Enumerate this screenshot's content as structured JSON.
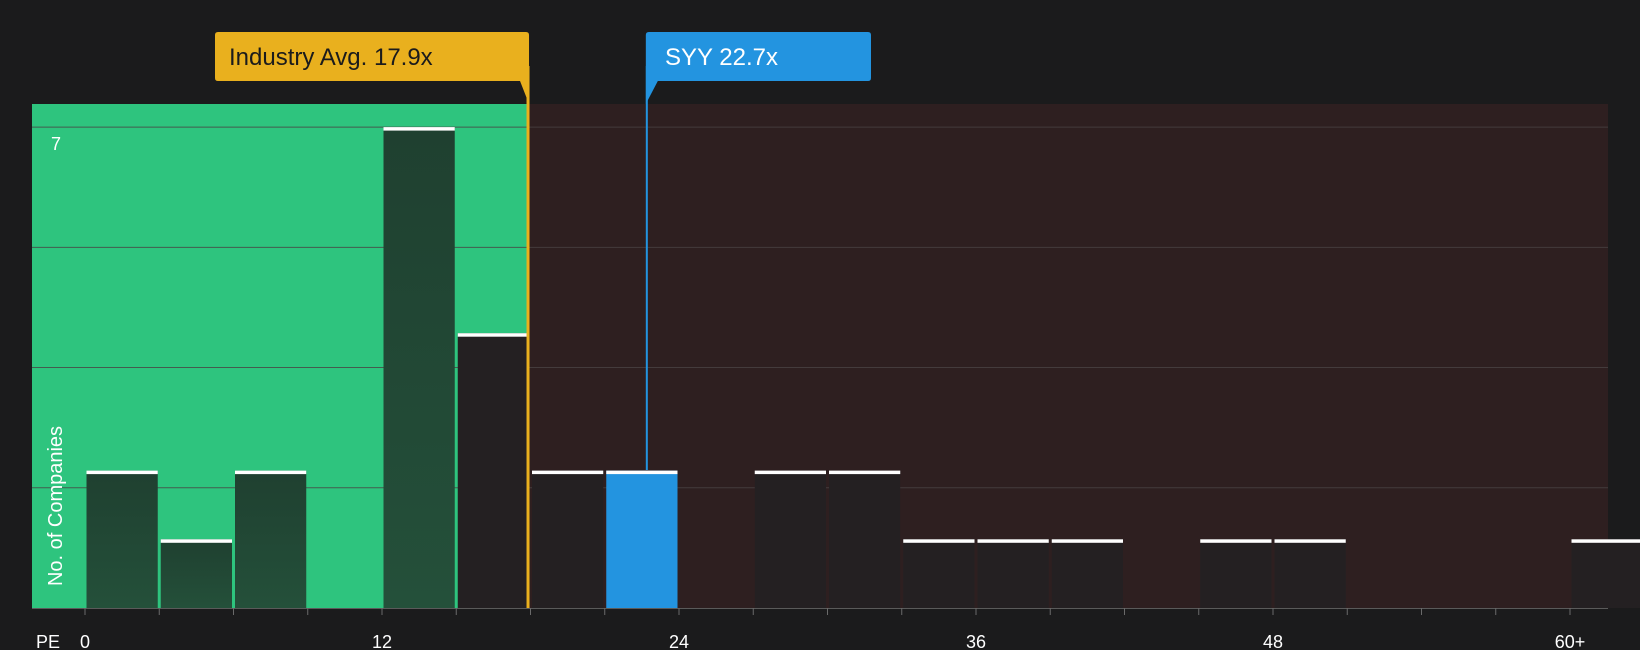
{
  "colors": {
    "background": "#1b1b1c",
    "below_avg_region": "#2ec47e",
    "above_avg_region": "#2e1f20",
    "bar_below": "#24503a",
    "bar_above": "#242022",
    "highlight_bar": "#2394e0",
    "industry_avg": "#e9b01e",
    "company": "#2394e0",
    "bar_top": "#ffffff",
    "grid": "#4a4244"
  },
  "chart_data": {
    "type": "bar",
    "title": "",
    "xlabel": "PE",
    "ylabel": "No. of Companies",
    "xlim": [
      0,
      61.5
    ],
    "ylim": [
      0,
      7.25
    ],
    "bin_width": 3,
    "x_ticks": [
      0,
      12,
      24,
      36,
      48,
      60
    ],
    "x_tick_labels": [
      "0",
      "12",
      "24",
      "36",
      "48",
      "60+"
    ],
    "y_tick_labels": [
      {
        "value": 7,
        "label": "7"
      }
    ],
    "grid": true,
    "bars": [
      {
        "x0": 0,
        "value": 2
      },
      {
        "x0": 3,
        "value": 1
      },
      {
        "x0": 6,
        "value": 2
      },
      {
        "x0": 12,
        "value": 7
      },
      {
        "x0": 15,
        "value": 4
      },
      {
        "x0": 18,
        "value": 2
      },
      {
        "x0": 21,
        "value": 2,
        "highlight": true
      },
      {
        "x0": 27,
        "value": 2
      },
      {
        "x0": 30,
        "value": 2
      },
      {
        "x0": 33,
        "value": 1
      },
      {
        "x0": 36,
        "value": 1
      },
      {
        "x0": 39,
        "value": 1
      },
      {
        "x0": 45,
        "value": 1
      },
      {
        "x0": 48,
        "value": 1
      },
      {
        "x0": 60,
        "value": 1
      }
    ],
    "industry_avg": {
      "value": 17.9,
      "label": "Industry Avg. 17.9x"
    },
    "company": {
      "value": 22.7,
      "label": "SYY 22.7x"
    }
  }
}
